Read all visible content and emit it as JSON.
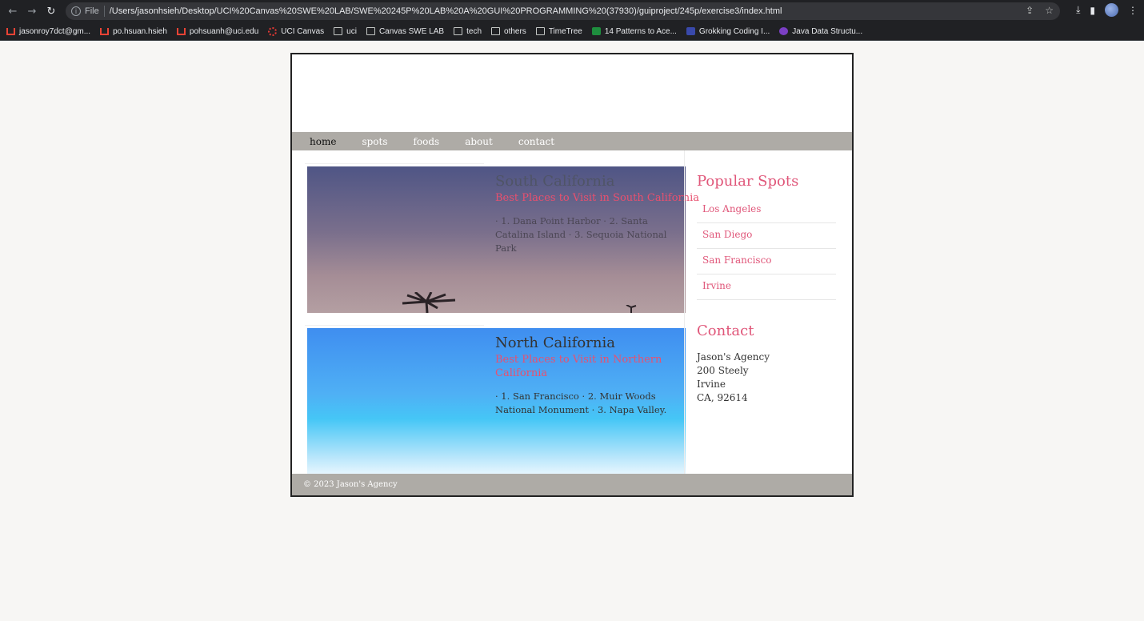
{
  "browser": {
    "address_prefix": "File",
    "url": "/Users/jasonhsieh/Desktop/UCI%20Canvas%20SWE%20LAB/SWE%20245P%20LAB%20A%20GUI%20PROGRAMMING%20(37930)/guiproject/245p/exercise3/index.html",
    "bookmarks": [
      {
        "label": "jasonroy7dct@gm...",
        "icon": "gmail-icon"
      },
      {
        "label": "po.hsuan.hsieh",
        "icon": "gmail-icon"
      },
      {
        "label": "pohsuanh@uci.edu",
        "icon": "gmail-icon"
      },
      {
        "label": "UCI Canvas",
        "icon": "canvas-icon"
      },
      {
        "label": "uci",
        "icon": "folder-icon"
      },
      {
        "label": "Canvas SWE LAB",
        "icon": "folder-icon"
      },
      {
        "label": "tech",
        "icon": "folder-icon"
      },
      {
        "label": "others",
        "icon": "folder-icon"
      },
      {
        "label": "TimeTree",
        "icon": "folder-icon"
      },
      {
        "label": "14 Patterns to Ace...",
        "icon": "patterns-icon"
      },
      {
        "label": "Grokking Coding I...",
        "icon": "grokking-icon"
      },
      {
        "label": "Java Data Structu...",
        "icon": "java-icon"
      }
    ]
  },
  "menu": [
    "home",
    "spots",
    "foods",
    "about",
    "contact"
  ],
  "posts": [
    {
      "title": "South California",
      "subtitle": "Best Places to Visit in South California",
      "body": "· 1. Dana Point Harbor · 2. Santa Catalina Island · 3. Sequoia National Park"
    },
    {
      "title": "North California",
      "subtitle": "Best Places to Visit in Northern California",
      "body": "· 1. San Francisco · 2. Muir Woods National Monument · 3. Napa Valley."
    }
  ],
  "sidebar": {
    "spots_heading": "Popular Spots",
    "spots": [
      "Los Angeles",
      "San Diego",
      "San Francisco",
      "Irvine"
    ],
    "contact_heading": "Contact",
    "contact_lines": [
      "Jason's Agency",
      "200 Steely",
      "Irvine",
      "CA, 92614"
    ]
  },
  "footer": "© 2023 Jason's Agency",
  "colors": {
    "accent": "#e0577a",
    "menu_bg": "#aeaba6",
    "page_bg": "#f7f6f4"
  }
}
